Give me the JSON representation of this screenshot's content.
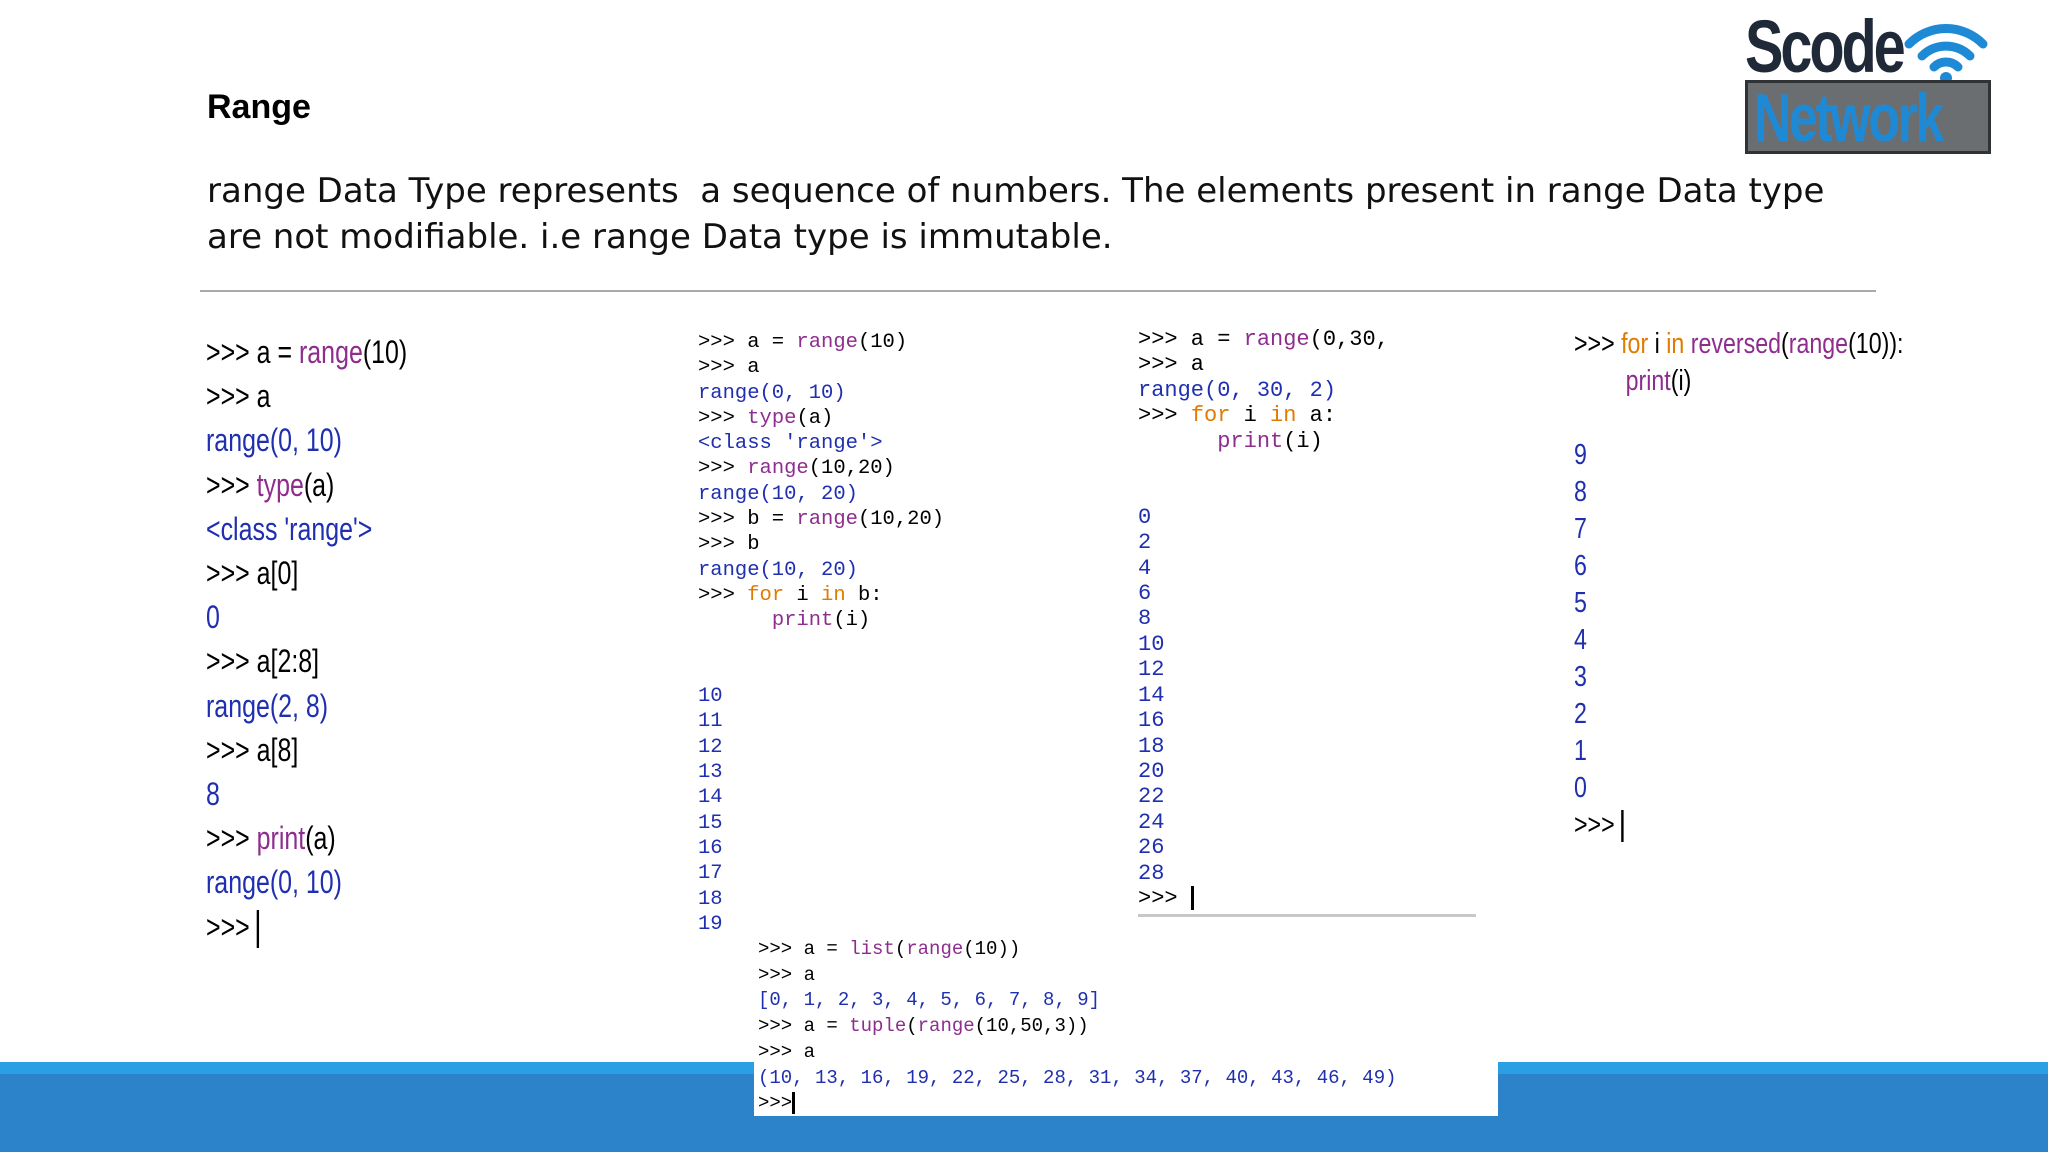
{
  "slide": {
    "title": "Range",
    "body_lines": [
      "range Data Type represents  a sequence of numbers. The elements present in range Data type",
      "are not modifiable. i.e range Data type is immutable."
    ]
  },
  "logo": {
    "line1": "Scode",
    "line2": "Network",
    "icon": "wifi-icon"
  },
  "colors": {
    "prompt": "#000000",
    "builtin": "#8e2d8e",
    "keyword": "#e07b00",
    "output": "#1f2fb0",
    "band_light": "#2a9fe3",
    "band_dark": "#2c83c9"
  },
  "panel1": {
    "lines": [
      [
        {
          "t": ">>> a = ",
          "c": "p"
        },
        {
          "t": "range",
          "c": "fn"
        },
        {
          "t": "(10)",
          "c": "p"
        }
      ],
      [
        {
          "t": ">>> a",
          "c": "p"
        }
      ],
      [
        {
          "t": "range(0, 10)",
          "c": "out"
        }
      ],
      [
        {
          "t": ">>> ",
          "c": "p"
        },
        {
          "t": "type",
          "c": "fn"
        },
        {
          "t": "(a)",
          "c": "p"
        }
      ],
      [
        {
          "t": "<class 'range'>",
          "c": "out"
        }
      ],
      [
        {
          "t": ">>> a[0]",
          "c": "p"
        }
      ],
      [
        {
          "t": "0",
          "c": "out"
        }
      ],
      [
        {
          "t": ">>> a[2:8]",
          "c": "p"
        }
      ],
      [
        {
          "t": "range(2, 8)",
          "c": "out"
        }
      ],
      [
        {
          "t": ">>> a[8]",
          "c": "p"
        }
      ],
      [
        {
          "t": "8",
          "c": "out"
        }
      ],
      [
        {
          "t": ">>> ",
          "c": "p"
        },
        {
          "t": "print",
          "c": "fn"
        },
        {
          "t": "(a)",
          "c": "p"
        }
      ],
      [
        {
          "t": "range(0, 10)",
          "c": "out"
        }
      ],
      [
        {
          "t": ">>> ",
          "c": "p"
        },
        {
          "cursor": true
        }
      ]
    ]
  },
  "panel2": {
    "lines": [
      [
        {
          "t": ">>> a = ",
          "c": "p"
        },
        {
          "t": "range",
          "c": "fn"
        },
        {
          "t": "(10)",
          "c": "p"
        }
      ],
      [
        {
          "t": ">>> a",
          "c": "p"
        }
      ],
      [
        {
          "t": "range(0, 10)",
          "c": "out"
        }
      ],
      [
        {
          "t": ">>> ",
          "c": "p"
        },
        {
          "t": "type",
          "c": "fn"
        },
        {
          "t": "(a)",
          "c": "p"
        }
      ],
      [
        {
          "t": "<class 'range'>",
          "c": "out"
        }
      ],
      [
        {
          "t": ">>> ",
          "c": "p"
        },
        {
          "t": "range",
          "c": "fn"
        },
        {
          "t": "(10,20)",
          "c": "p"
        }
      ],
      [
        {
          "t": "range(10, 20)",
          "c": "out"
        }
      ],
      [
        {
          "t": ">>> b = ",
          "c": "p"
        },
        {
          "t": "range",
          "c": "fn"
        },
        {
          "t": "(10,20)",
          "c": "p"
        }
      ],
      [
        {
          "t": ">>> b",
          "c": "p"
        }
      ],
      [
        {
          "t": "range(10, 20)",
          "c": "out"
        }
      ],
      [
        {
          "t": ">>> ",
          "c": "p"
        },
        {
          "t": "for",
          "c": "kw"
        },
        {
          "t": " i ",
          "c": "p"
        },
        {
          "t": "in",
          "c": "kw"
        },
        {
          "t": " b:",
          "c": "p"
        }
      ],
      [
        {
          "t": "      ",
          "c": "p"
        },
        {
          "t": "print",
          "c": "fn"
        },
        {
          "t": "(i)",
          "c": "p"
        }
      ],
      [
        {
          "t": "",
          "c": "p"
        }
      ],
      [
        {
          "t": "",
          "c": "p"
        }
      ],
      [
        {
          "t": "10",
          "c": "out"
        }
      ],
      [
        {
          "t": "11",
          "c": "out"
        }
      ],
      [
        {
          "t": "12",
          "c": "out"
        }
      ],
      [
        {
          "t": "13",
          "c": "out"
        }
      ],
      [
        {
          "t": "14",
          "c": "out"
        }
      ],
      [
        {
          "t": "15",
          "c": "out"
        }
      ],
      [
        {
          "t": "16",
          "c": "out"
        }
      ],
      [
        {
          "t": "17",
          "c": "out"
        }
      ],
      [
        {
          "t": "18",
          "c": "out"
        }
      ],
      [
        {
          "t": "19",
          "c": "out"
        }
      ]
    ]
  },
  "panel3": {
    "lines": [
      [
        {
          "t": ">>> a = ",
          "c": "p"
        },
        {
          "t": "range",
          "c": "fn"
        },
        {
          "t": "(0,30,",
          "c": "p"
        }
      ],
      [
        {
          "t": ">>> a",
          "c": "p"
        }
      ],
      [
        {
          "t": "range(0, 30, 2)",
          "c": "out"
        }
      ],
      [
        {
          "t": ">>> ",
          "c": "p"
        },
        {
          "t": "for",
          "c": "kw"
        },
        {
          "t": " i ",
          "c": "p"
        },
        {
          "t": "in",
          "c": "kw"
        },
        {
          "t": " a:",
          "c": "p"
        }
      ],
      [
        {
          "t": "      ",
          "c": "p"
        },
        {
          "t": "print",
          "c": "fn"
        },
        {
          "t": "(i)",
          "c": "p"
        }
      ],
      [
        {
          "t": "",
          "c": "p"
        }
      ],
      [
        {
          "t": "",
          "c": "p"
        }
      ],
      [
        {
          "t": "0",
          "c": "out"
        }
      ],
      [
        {
          "t": "2",
          "c": "out"
        }
      ],
      [
        {
          "t": "4",
          "c": "out"
        }
      ],
      [
        {
          "t": "6",
          "c": "out"
        }
      ],
      [
        {
          "t": "8",
          "c": "out"
        }
      ],
      [
        {
          "t": "10",
          "c": "out"
        }
      ],
      [
        {
          "t": "12",
          "c": "out"
        }
      ],
      [
        {
          "t": "14",
          "c": "out"
        }
      ],
      [
        {
          "t": "16",
          "c": "out"
        }
      ],
      [
        {
          "t": "18",
          "c": "out"
        }
      ],
      [
        {
          "t": "20",
          "c": "out"
        }
      ],
      [
        {
          "t": "22",
          "c": "out"
        }
      ],
      [
        {
          "t": "24",
          "c": "out"
        }
      ],
      [
        {
          "t": "26",
          "c": "out"
        }
      ],
      [
        {
          "t": "28",
          "c": "out"
        }
      ],
      [
        {
          "t": ">>> ",
          "c": "p"
        },
        {
          "cursor": true
        }
      ]
    ]
  },
  "panel4": {
    "lines": [
      [
        {
          "t": ">>> ",
          "c": "p"
        },
        {
          "t": "for",
          "c": "kw"
        },
        {
          "t": " i ",
          "c": "p"
        },
        {
          "t": "in",
          "c": "kw"
        },
        {
          "t": " ",
          "c": "p"
        },
        {
          "t": "reversed",
          "c": "fn"
        },
        {
          "t": "(",
          "c": "p"
        },
        {
          "t": "range",
          "c": "fn"
        },
        {
          "t": "(10)):",
          "c": "p"
        }
      ],
      [
        {
          "t": "        ",
          "c": "p"
        },
        {
          "t": "print",
          "c": "fn"
        },
        {
          "t": "(i)",
          "c": "p"
        }
      ],
      [
        {
          "t": "",
          "c": "p"
        }
      ],
      [
        {
          "t": "9",
          "c": "out"
        }
      ],
      [
        {
          "t": "8",
          "c": "out"
        }
      ],
      [
        {
          "t": "7",
          "c": "out"
        }
      ],
      [
        {
          "t": "6",
          "c": "out"
        }
      ],
      [
        {
          "t": "5",
          "c": "out"
        }
      ],
      [
        {
          "t": "4",
          "c": "out"
        }
      ],
      [
        {
          "t": "3",
          "c": "out"
        }
      ],
      [
        {
          "t": "2",
          "c": "out"
        }
      ],
      [
        {
          "t": "1",
          "c": "out"
        }
      ],
      [
        {
          "t": "0",
          "c": "out"
        }
      ],
      [
        {
          "t": ">>> ",
          "c": "p"
        },
        {
          "cursor": true
        }
      ]
    ]
  },
  "panel5": {
    "lines": [
      [
        {
          "t": ">>> a = ",
          "c": "p"
        },
        {
          "t": "list",
          "c": "fn"
        },
        {
          "t": "(",
          "c": "p"
        },
        {
          "t": "range",
          "c": "fn"
        },
        {
          "t": "(10))",
          "c": "p"
        }
      ],
      [
        {
          "t": ">>> a",
          "c": "p"
        }
      ],
      [
        {
          "t": "[0, 1, 2, 3, 4, 5, 6, 7, 8, 9]",
          "c": "out"
        }
      ],
      [
        {
          "t": ">>> a = ",
          "c": "p"
        },
        {
          "t": "tuple",
          "c": "fn"
        },
        {
          "t": "(",
          "c": "p"
        },
        {
          "t": "range",
          "c": "fn"
        },
        {
          "t": "(10,50,3))",
          "c": "p"
        }
      ],
      [
        {
          "t": ">>> a",
          "c": "p"
        }
      ],
      [
        {
          "t": "(10, 13, 16, 19, 22, 25, 28, 31, 34, 37, 40, 43, 46, 49)",
          "c": "out"
        }
      ],
      [
        {
          "t": ">>>",
          "c": "p"
        },
        {
          "cursor": true
        }
      ]
    ]
  }
}
